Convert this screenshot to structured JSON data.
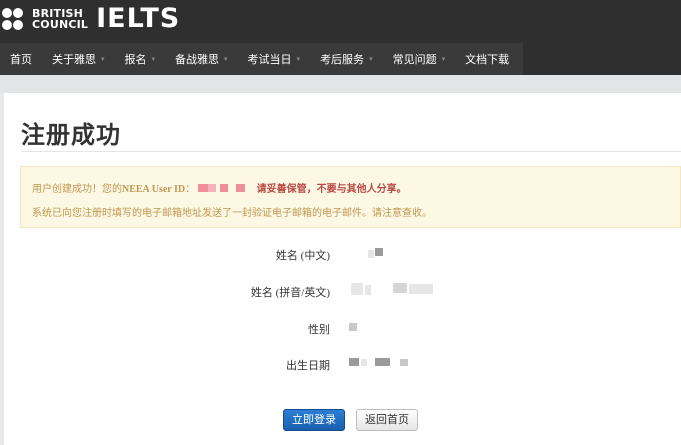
{
  "header": {
    "brand_line1": "BRITISH",
    "brand_line2": "COUNCIL",
    "product": "IELTS"
  },
  "nav": {
    "items": [
      {
        "label": "首页",
        "has_caret": false
      },
      {
        "label": "关于雅思",
        "has_caret": true
      },
      {
        "label": "报名",
        "has_caret": true
      },
      {
        "label": "备战雅思",
        "has_caret": true
      },
      {
        "label": "考试当日",
        "has_caret": true
      },
      {
        "label": "考后服务",
        "has_caret": true
      },
      {
        "label": "常见问题",
        "has_caret": true
      },
      {
        "label": "文档下载",
        "has_caret": false
      }
    ],
    "caret_icon": "chevron-down-icon"
  },
  "page": {
    "title": "注册成功"
  },
  "alert": {
    "line1_prefix": "用户创建成功！您的",
    "line1_id_label": "NEEA User ID",
    "line1_colon": "：",
    "line1_warning": "请妥善保管，不要与其他人分享。",
    "line2": "系统已向您注册时填写的电子邮箱地址发送了一封验证电子邮箱的电子邮件。请注意查收。"
  },
  "form": {
    "fields": [
      {
        "label": "姓名 (中文)"
      },
      {
        "label": "姓名 (拼音/英文)"
      },
      {
        "label": "性别"
      },
      {
        "label": "出生日期"
      }
    ]
  },
  "buttons": {
    "login": "立即登录",
    "home": "返回首页"
  },
  "colors": {
    "header_bg": "#2f2f2f",
    "nav_bg": "#3a3a3a",
    "alert_bg": "#fcf8e3",
    "alert_text": "#c09853",
    "alert_warning": "#b94a48",
    "primary_button": "#1b5fae"
  }
}
